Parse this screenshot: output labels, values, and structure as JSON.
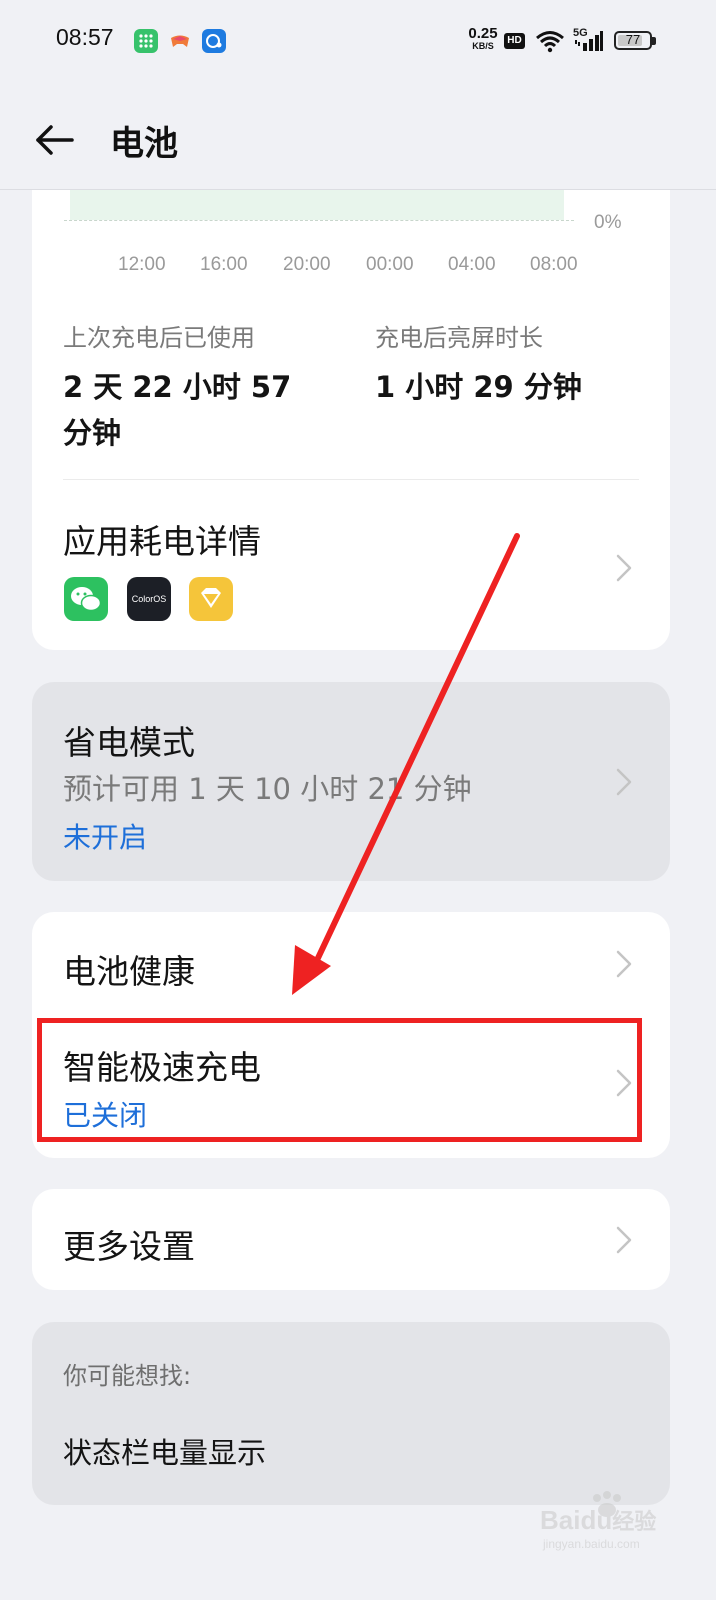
{
  "status_bar": {
    "time": "08:57",
    "net_speed_value": "0.25",
    "net_speed_unit": "KB/S",
    "hd": "HD",
    "network": "5G",
    "battery_level": "77"
  },
  "header": {
    "title": "电池"
  },
  "chart": {
    "y_label": "0%",
    "x_ticks": [
      "12:00",
      "16:00",
      "20:00",
      "00:00",
      "04:00",
      "08:00"
    ]
  },
  "usage": {
    "since_charge_label": "上次充电后已使用",
    "since_charge_value_line1": "2 天 22 小时 57",
    "since_charge_value_line2": "分钟",
    "screen_on_label": "充电后亮屏时长",
    "screen_on_value": "1 小时 29 分钟"
  },
  "app_usage": {
    "title": "应用耗电详情",
    "icons": [
      "wechat-icon",
      "coloros-icon",
      "diamond-app-icon"
    ],
    "coloros_text": "ColorOS"
  },
  "power_saving": {
    "title": "省电模式",
    "estimate": "预计可用 1 天 10 小时 21 分钟",
    "status": "未开启"
  },
  "battery_health": {
    "title": "电池健康"
  },
  "smart_charge": {
    "title": "智能极速充电",
    "status": "已关闭"
  },
  "more_settings": {
    "title": "更多设置"
  },
  "suggestions": {
    "heading": "你可能想找:",
    "item": "状态栏电量显示"
  },
  "watermark": {
    "brand": "Baidu",
    "brand_cn": "经验",
    "url": "jingyan.baidu.com"
  },
  "colors": {
    "accent_blue": "#1e6fd9",
    "annotation_red": "#ee2222",
    "chart_fill": "#e8f5ec"
  }
}
